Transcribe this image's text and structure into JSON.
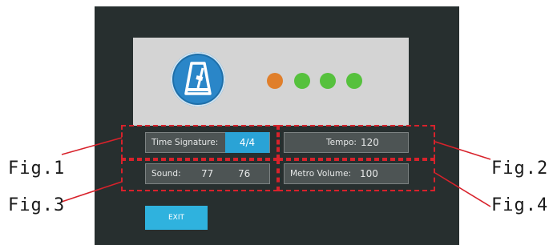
{
  "colors": {
    "screen_bg": "#272f2f",
    "panel_bg": "#d4d4d4",
    "accent_blue": "#2aa3d6",
    "dashed_callout": "#d8222b",
    "beat_active": "#e07f2b",
    "beat_inactive": "#56c13d"
  },
  "header": {
    "icon": "metronome-icon",
    "beats": [
      {
        "state": "active",
        "color": "#e07f2b"
      },
      {
        "state": "inactive",
        "color": "#56c13d"
      },
      {
        "state": "inactive",
        "color": "#56c13d"
      },
      {
        "state": "inactive",
        "color": "#56c13d"
      }
    ]
  },
  "settings": {
    "time_signature": {
      "label": "Time Signature:",
      "value": "4/4"
    },
    "tempo": {
      "label": "Tempo:",
      "value": "120"
    },
    "sound": {
      "label": "Sound:",
      "value1": "77",
      "value2": "76"
    },
    "metro_volume": {
      "label": "Metro Volume:",
      "value": "100"
    }
  },
  "exit_button": {
    "label": "EXIT"
  },
  "annotations": {
    "fig1": "Fig.1",
    "fig2": "Fig.2",
    "fig3": "Fig.3",
    "fig4": "Fig.4"
  }
}
